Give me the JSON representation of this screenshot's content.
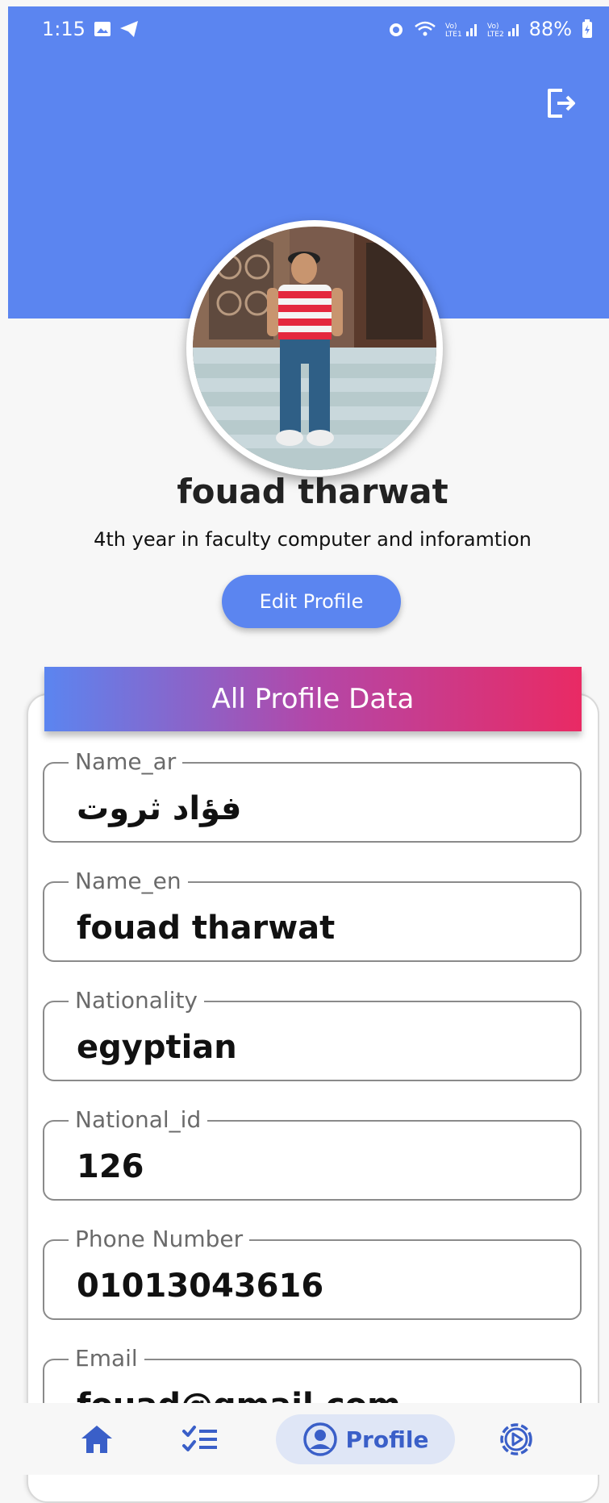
{
  "status_bar": {
    "time": "1:15",
    "battery": "88%"
  },
  "profile": {
    "name": "fouad tharwat",
    "subtitle": "4th year in faculty computer and inforamtion",
    "edit_button": "Edit Profile"
  },
  "card": {
    "title": "All Profile Data",
    "fields": [
      {
        "label": "Name_ar",
        "value": "فؤاد ثروت"
      },
      {
        "label": "Name_en",
        "value": "fouad tharwat"
      },
      {
        "label": "Nationality",
        "value": "egyptian"
      },
      {
        "label": "National_id",
        "value": "126"
      },
      {
        "label": "Phone Number",
        "value": "01013043616"
      },
      {
        "label": "Email",
        "value": "fouad@gmail.com"
      }
    ]
  },
  "bottom_nav": {
    "items": [
      {
        "icon": "home-icon"
      },
      {
        "icon": "checklist-icon"
      },
      {
        "icon": "person-icon",
        "label": "Profile",
        "active": true
      },
      {
        "icon": "settings-icon"
      }
    ]
  },
  "colors": {
    "primary": "#5b85f0",
    "gradient_end": "#e92a64",
    "nav_active_bg": "#dfe6f6"
  }
}
